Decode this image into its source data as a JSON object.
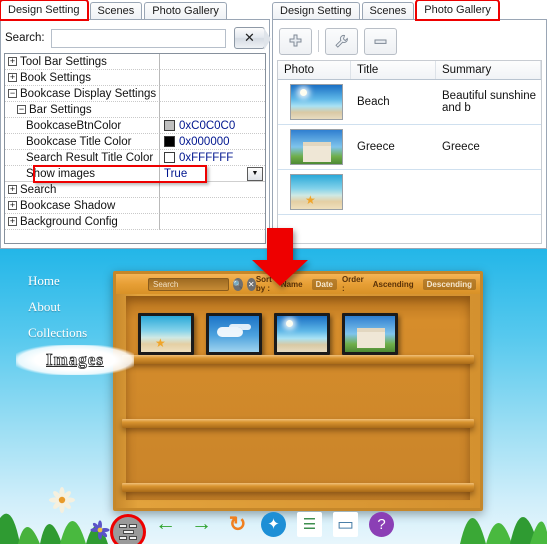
{
  "left_panel": {
    "tabs": [
      {
        "label": "Design Setting",
        "active": true,
        "highlighted": true
      },
      {
        "label": "Scenes",
        "active": false,
        "highlighted": false
      },
      {
        "label": "Photo Gallery",
        "active": false,
        "highlighted": false
      }
    ],
    "search": {
      "label": "Search:",
      "value": "",
      "placeholder": "",
      "clear_icon": "close-icon"
    },
    "properties": [
      {
        "name": "Tool Bar Settings",
        "expander": "+",
        "indent": 0,
        "value": "",
        "kind": "group"
      },
      {
        "name": "Book Settings",
        "expander": "+",
        "indent": 0,
        "value": "",
        "kind": "group"
      },
      {
        "name": "Bookcase Display Settings",
        "expander": "-",
        "indent": 0,
        "value": "",
        "kind": "group"
      },
      {
        "name": "Bar Settings",
        "expander": "-",
        "indent": 1,
        "value": "",
        "kind": "group"
      },
      {
        "name": "BookcaseBtnColor",
        "expander": "",
        "indent": 2,
        "value": "0xC0C0C0",
        "kind": "color",
        "swatch": "#C0C0C0"
      },
      {
        "name": "Bookcase Title Color",
        "expander": "",
        "indent": 2,
        "value": "0x000000",
        "kind": "color",
        "swatch": "#000000"
      },
      {
        "name": "Search Result Title Color",
        "expander": "",
        "indent": 2,
        "value": "0xFFFFFF",
        "kind": "color",
        "swatch": "#FFFFFF"
      },
      {
        "name": "Show images",
        "expander": "",
        "indent": 2,
        "value": "True",
        "kind": "dropdown",
        "selected": true
      },
      {
        "name": "Search",
        "expander": "+",
        "indent": 0,
        "value": "",
        "kind": "group"
      },
      {
        "name": "Bookcase Shadow",
        "expander": "+",
        "indent": 0,
        "value": "",
        "kind": "group"
      },
      {
        "name": "Background Config",
        "expander": "+",
        "indent": 0,
        "value": "",
        "kind": "group"
      }
    ]
  },
  "right_panel": {
    "tabs": [
      {
        "label": "Design Setting",
        "active": false,
        "highlighted": false
      },
      {
        "label": "Scenes",
        "active": false,
        "highlighted": false
      },
      {
        "label": "Photo Gallery",
        "active": true,
        "highlighted": true
      }
    ],
    "toolbar": [
      {
        "name": "add-button",
        "icon": "plus-icon"
      },
      {
        "name": "edit-button",
        "icon": "wrench-icon"
      },
      {
        "name": "remove-button",
        "icon": "minus-icon"
      }
    ],
    "table": {
      "columns": [
        "Photo",
        "Title",
        "Summary"
      ],
      "rows": [
        {
          "photo": "beach-thumbnail",
          "art": "art-beach",
          "title": "Beach",
          "summary": "Beautiful sunshine and b"
        },
        {
          "photo": "greece-thumbnail",
          "art": "art-greece",
          "title": "Greece",
          "summary": "Greece"
        },
        {
          "photo": "starfish-thumbnail",
          "art": "art-star",
          "title": "",
          "summary": ""
        }
      ]
    }
  },
  "preview": {
    "nav": {
      "items": [
        "Home",
        "About",
        "Collections"
      ],
      "active_item": "Images"
    },
    "bookcase_bar": {
      "menu_icon": "list-menu-icon",
      "search_placeholder": "Search",
      "search_icon": "magnifier-icon",
      "clear_icon": "close-icon",
      "sort_by_label": "Sort by :",
      "sort_options": [
        {
          "label": "Name",
          "selected": false
        },
        {
          "label": "Date",
          "selected": true
        }
      ],
      "order_label": "Order :",
      "order_options": [
        {
          "label": "Ascending",
          "selected": false
        },
        {
          "label": "Descending",
          "selected": true
        }
      ]
    },
    "shelves": [
      {
        "items": [
          "art-star",
          "art-clouds",
          "art-beach",
          "art-greece"
        ]
      },
      {
        "items": []
      },
      {
        "items": []
      }
    ],
    "dock": [
      {
        "name": "back-icon",
        "glyph": "←",
        "color": "#2fa32f"
      },
      {
        "name": "forward-icon",
        "glyph": "→",
        "color": "#2fa32f"
      },
      {
        "name": "refresh-icon",
        "glyph": "↻",
        "color": "#f08020"
      },
      {
        "name": "share-icon",
        "glyph": "✦",
        "color": "#1d8fd6"
      },
      {
        "name": "list-icon",
        "glyph": "☰",
        "color": "#3f8f4f"
      },
      {
        "name": "monitor-icon",
        "glyph": "▭",
        "color": "#4a7fa8"
      },
      {
        "name": "help-icon",
        "glyph": "?",
        "color": "#8b3fb5"
      }
    ]
  },
  "annotations": {
    "arrow_color": "#ee0000",
    "arrow_name": "red-down-arrow"
  }
}
